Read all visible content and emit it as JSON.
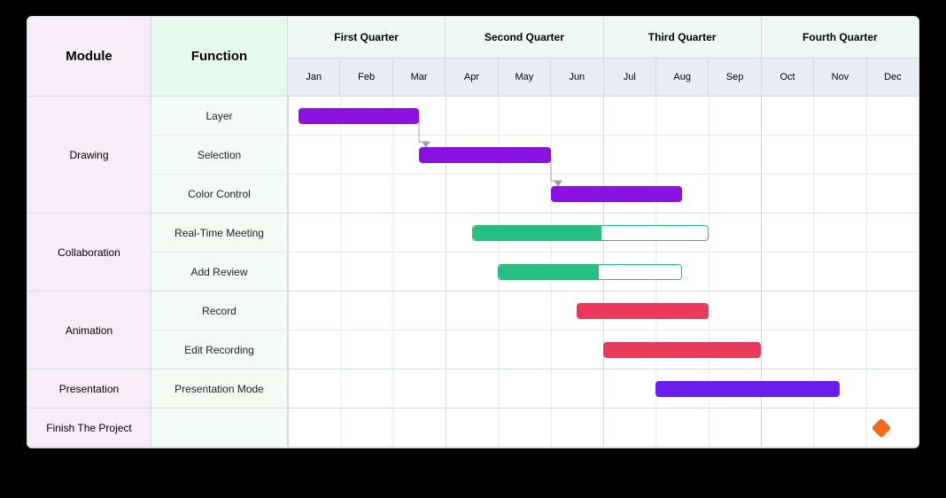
{
  "chart_data": {
    "type": "gantt",
    "title": "",
    "x_unit": "month",
    "columns": {
      "module": "Module",
      "function": "Function"
    },
    "quarters": [
      "First Quarter",
      "Second Quarter",
      "Third Quarter",
      "Fourth Quarter"
    ],
    "months": [
      "Jan",
      "Feb",
      "Mar",
      "Apr",
      "May",
      "Jun",
      "Jul",
      "Aug",
      "Sep",
      "Oct",
      "Nov",
      "Dec"
    ],
    "modules": [
      {
        "name": "Drawing",
        "tasks": [
          {
            "name": "Layer",
            "start": 0.2,
            "end": 2.5,
            "color": "#8A12E0",
            "progress": 1.0
          },
          {
            "name": "Selection",
            "start": 2.5,
            "end": 5.0,
            "color": "#8A12E0",
            "progress": 1.0
          },
          {
            "name": "Color Control",
            "start": 5.0,
            "end": 7.5,
            "color": "#8A12E0",
            "progress": 1.0
          }
        ]
      },
      {
        "name": "Collaboration",
        "tasks": [
          {
            "name": "Real-Time Meeting",
            "start": 3.5,
            "end": 8.0,
            "color": "#26BF80",
            "progress": 0.55
          },
          {
            "name": "Add Review",
            "start": 4.0,
            "end": 7.5,
            "color": "#26BF80",
            "progress": 0.55
          }
        ]
      },
      {
        "name": "Animation",
        "tasks": [
          {
            "name": "Record",
            "start": 5.5,
            "end": 8.0,
            "color": "#EA3A5B",
            "progress": 1.0
          },
          {
            "name": "Edit Recording",
            "start": 6.0,
            "end": 9.0,
            "color": "#EA3A5B",
            "progress": 1.0
          }
        ]
      },
      {
        "name": "Presentation",
        "tasks": [
          {
            "name": "Presentation Mode",
            "start": 7.0,
            "end": 10.5,
            "color": "#6B1CF0",
            "progress": 1.0
          }
        ]
      },
      {
        "name": "Finish The Project",
        "tasks": [
          {
            "name": "",
            "milestone": true,
            "at": 11.3,
            "color": "#F56A17"
          }
        ]
      }
    ],
    "dependencies": [
      {
        "from": [
          0,
          0
        ],
        "to": [
          0,
          1
        ]
      },
      {
        "from": [
          0,
          1
        ],
        "to": [
          0,
          2
        ]
      }
    ]
  }
}
